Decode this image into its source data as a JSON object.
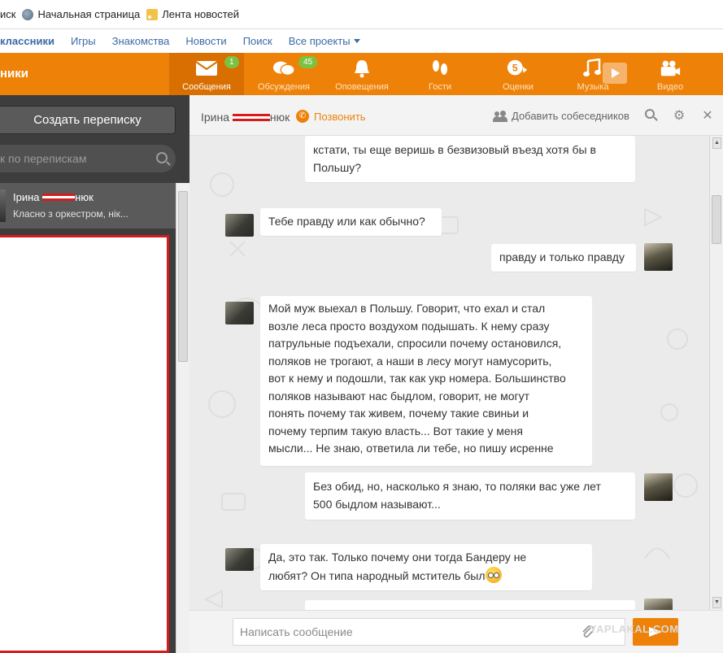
{
  "bookmarks": [
    {
      "label": "иск",
      "icon": "none"
    },
    {
      "label": "Начальная страница",
      "icon": "globe-icon"
    },
    {
      "label": "Лента новостей",
      "icon": "rss-icon"
    }
  ],
  "site_links": {
    "brand": "классники",
    "items": [
      "Игры",
      "Знакомства",
      "Новости",
      "Поиск",
      "Все проекты"
    ]
  },
  "header": {
    "site_name": "ники",
    "nav": [
      {
        "label": "Сообщения",
        "icon": "envelope-icon",
        "badge": "1",
        "active": true
      },
      {
        "label": "Обсуждения",
        "icon": "chat-bubbles-icon",
        "badge": "45",
        "active": false
      },
      {
        "label": "Оповещения",
        "icon": "bell-icon",
        "badge": "",
        "active": false
      },
      {
        "label": "Гости",
        "icon": "footprints-icon",
        "badge": "",
        "active": false
      },
      {
        "label": "Оценки",
        "icon": "five-rating-icon",
        "badge": "",
        "active": false
      },
      {
        "label": "Музыка",
        "icon": "music-note-icon",
        "badge": "",
        "active": false
      },
      {
        "label": "Видео",
        "icon": "video-camera-icon",
        "badge": "",
        "active": false
      }
    ]
  },
  "sidebar": {
    "create_button": "Создать переписку",
    "search_placeholder": "к по перепискам",
    "conversation": {
      "name_start": "Ірина",
      "name_end": "нюк",
      "snippet": "Класно з оркестром, нік..."
    }
  },
  "chat": {
    "header_name_start": "Ірина",
    "header_name_end": "нюк",
    "call_label": "Позвонить",
    "add_label": "Добавить собеседников",
    "input_placeholder": "Написать сообщение",
    "watermark": "YAPLAKAL.COM",
    "messages": [
      {
        "from": "me",
        "lines": [
          "кстати, ты еще веришь в безвизовый въезд хотя бы в",
          "Польшу?"
        ]
      },
      {
        "from": "them",
        "lines": [
          "Тебе правду или как обычно?"
        ]
      },
      {
        "from": "me",
        "lines": [
          "правду и только правду"
        ]
      },
      {
        "from": "them",
        "lines": [
          "Мой муж выехал в Польшу. Говорит, что ехал и стал",
          "возле леса просто воздухом подышать. К нему сразу",
          "патрульные подъехали, спросили почему остановился,",
          "поляков не трогают, а наши в лесу могут намусорить,",
          "вот к нему и подошли, так как укр номера. Большинство",
          "поляков называют нас быдлом, говорит, не могут",
          "понять почему так живем, почему такие свиньи и",
          "почему терпим такую власть... Вот такие у меня",
          "мысли... Не знаю, ответила ли тебе, но пишу исренне"
        ]
      },
      {
        "from": "me",
        "lines": [
          "Без обид, но, насколько я знаю, то поляки вас уже лет",
          "500 быдлом называют..."
        ]
      },
      {
        "from": "them",
        "lines": [
          "Да, это так. Только почему они тогда Бандеру не",
          "любят? Он типа народный мститель был"
        ]
      }
    ]
  },
  "colors": {
    "accent": "#ee8208",
    "accent_dark": "#d96f00",
    "badge": "#7bc240",
    "redaction": "#d41c1c",
    "link": "#3a6aa8"
  }
}
